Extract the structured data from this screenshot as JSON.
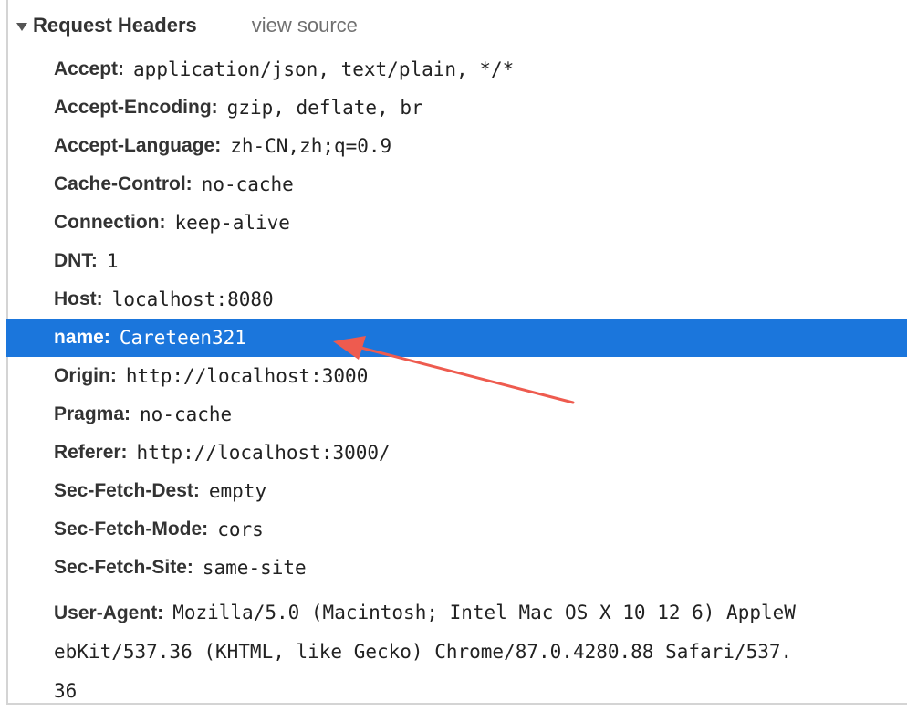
{
  "section": {
    "title": "Request Headers",
    "view_source": "view source"
  },
  "headers": [
    {
      "name": "Accept:",
      "value": "application/json, text/plain, */*"
    },
    {
      "name": "Accept-Encoding:",
      "value": "gzip, deflate, br"
    },
    {
      "name": "Accept-Language:",
      "value": "zh-CN,zh;q=0.9"
    },
    {
      "name": "Cache-Control:",
      "value": "no-cache"
    },
    {
      "name": "Connection:",
      "value": "keep-alive"
    },
    {
      "name": "DNT:",
      "value": "1"
    },
    {
      "name": "Host:",
      "value": "localhost:8080"
    },
    {
      "name": "name:",
      "value": "Careteen321"
    },
    {
      "name": "Origin:",
      "value": "http://localhost:3000"
    },
    {
      "name": "Pragma:",
      "value": "no-cache"
    },
    {
      "name": "Referer:",
      "value": "http://localhost:3000/"
    },
    {
      "name": "Sec-Fetch-Dest:",
      "value": "empty"
    },
    {
      "name": "Sec-Fetch-Mode:",
      "value": "cors"
    },
    {
      "name": "Sec-Fetch-Site:",
      "value": "same-site"
    }
  ],
  "user_agent": {
    "name": "User-Agent:",
    "lines": [
      "Mozilla/5.0 (Macintosh; Intel Mac OS X 10_12_6) AppleW",
      "ebKit/537.36 (KHTML, like Gecko) Chrome/87.0.4280.88 Safari/537.",
      "36"
    ]
  },
  "colors": {
    "highlight": "#1b76dc",
    "arrow": "#ee5b4f"
  },
  "icons": {
    "collapse_toggle": "triangle-down-icon",
    "annotation": "red-arrow-icon"
  }
}
